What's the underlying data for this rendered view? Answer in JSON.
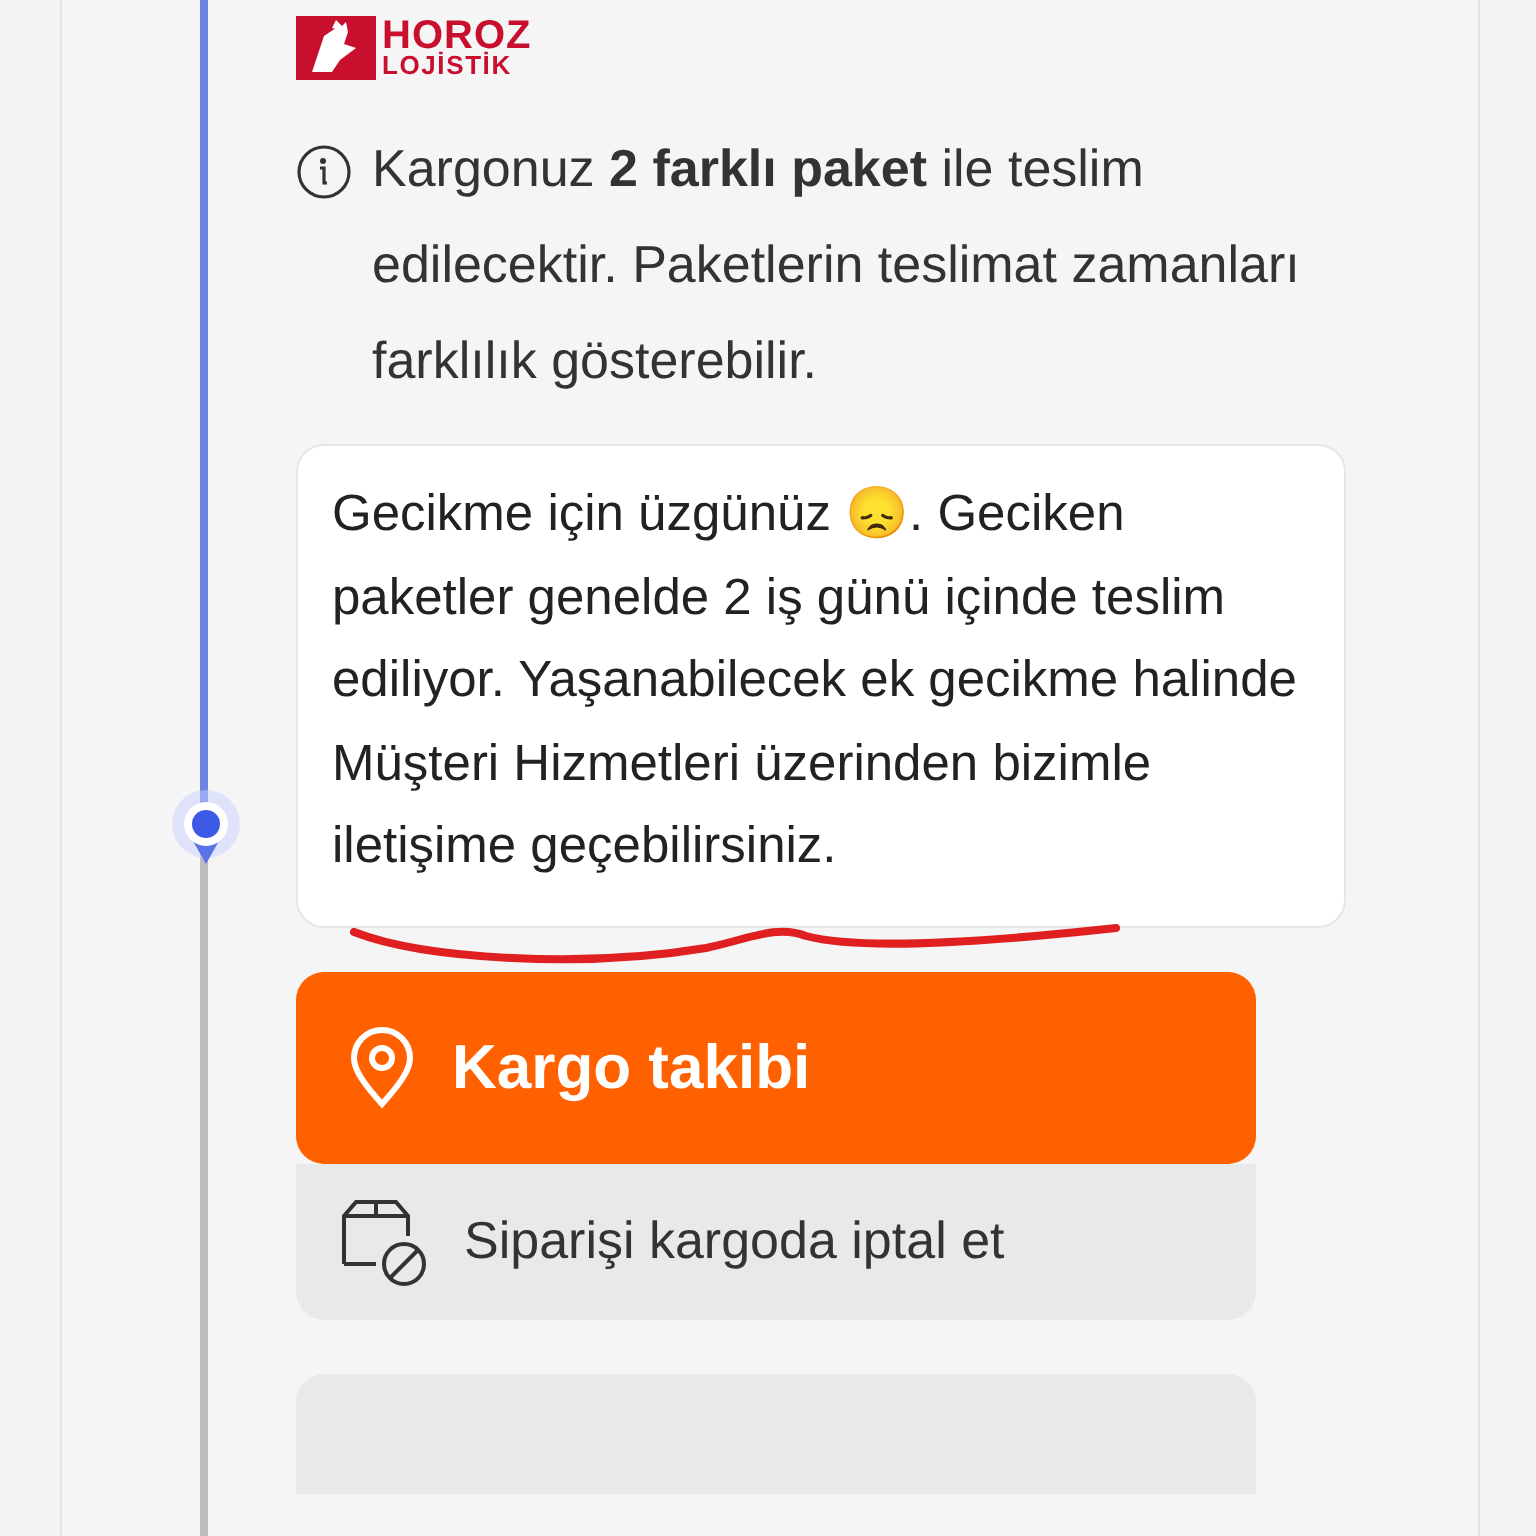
{
  "logo": {
    "line_1": "HOROZ",
    "line_2": "LOJİSTİK"
  },
  "info_note": "Kargonuz **2 farklı paket** ile teslim edilecektir. Paketlerin teslimat zamanları farklılık gösterebilir.",
  "message": "Gecikme için üzgünüz 😞. Geciken paketler genelde 2 iş günü içinde teslim ediliyor. Yaşanabilecek ek gecikme halinde Müşteri Hizmetleri üzerinden bizimle iletişime geçebilirsiniz.",
  "buttons": [
    {
      "kind": "primary",
      "label": "Kargo takibi"
    },
    {
      "kind": "secondary",
      "label": "Siparişi kargoda iptal et"
    }
  ]
}
